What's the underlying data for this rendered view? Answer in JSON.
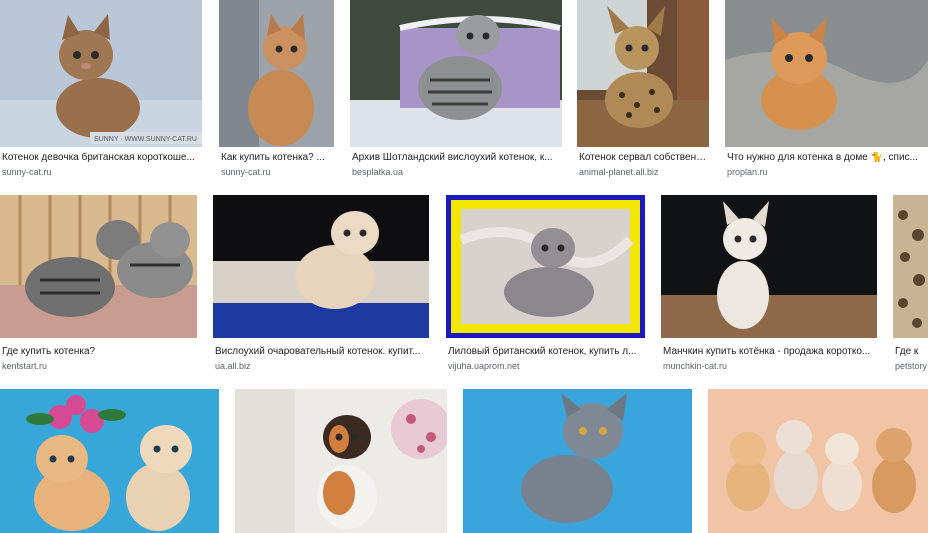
{
  "results": {
    "row1": [
      {
        "title": "Котенок девочка британская короткоше...",
        "source": "sunny-cat.ru",
        "image": "british shorthair kitten on blue",
        "watermark": "SUNNY · WWW.SUNNY-CAT.RU"
      },
      {
        "title": "Как купить котенка? ...",
        "source": "sunny-cat.ru",
        "image": "ginger kitten on grey"
      },
      {
        "title": "Архив Шотландский вислоухий котенок, к...",
        "source": "besplatka.ua",
        "image": "scottish fold tabby kitten with basket"
      },
      {
        "title": "Котенок сервал собственн...",
        "source": "animal-planet.all.biz",
        "image": "serval kitten by window"
      },
      {
        "title": "Что нужно для котенка в доме 🐈, спис...",
        "source": "proplan.ru",
        "image": "ginger kitten in blanket"
      }
    ],
    "row2": [
      {
        "title": "Где купить котенка?",
        "source": "kentstart.ru",
        "image": "two tabby kittens on mat"
      },
      {
        "title": "Вислоухий очаровательный котенок. купит...",
        "source": "ua.all.biz",
        "image": "cream fold kitten on blue cushion"
      },
      {
        "title": "Лиловый британский котенок, купить л...",
        "source": "vijuha.uaprom.net",
        "image": "lilac british kitten framed"
      },
      {
        "title": "Манчкин купить котёнка - продажа коротко...",
        "source": "munchkin-cat.ru",
        "image": "white munchkin kitten on dark"
      },
      {
        "title": "Где к",
        "source": "petstory",
        "image": "leopard patterned cat partial"
      }
    ],
    "row3": [
      {
        "image": "two golden kittens with pink flowers"
      },
      {
        "image": "calico kitten on white"
      },
      {
        "image": "grey british kitten on blue"
      },
      {
        "image": "four kittens on peach background"
      }
    ]
  }
}
